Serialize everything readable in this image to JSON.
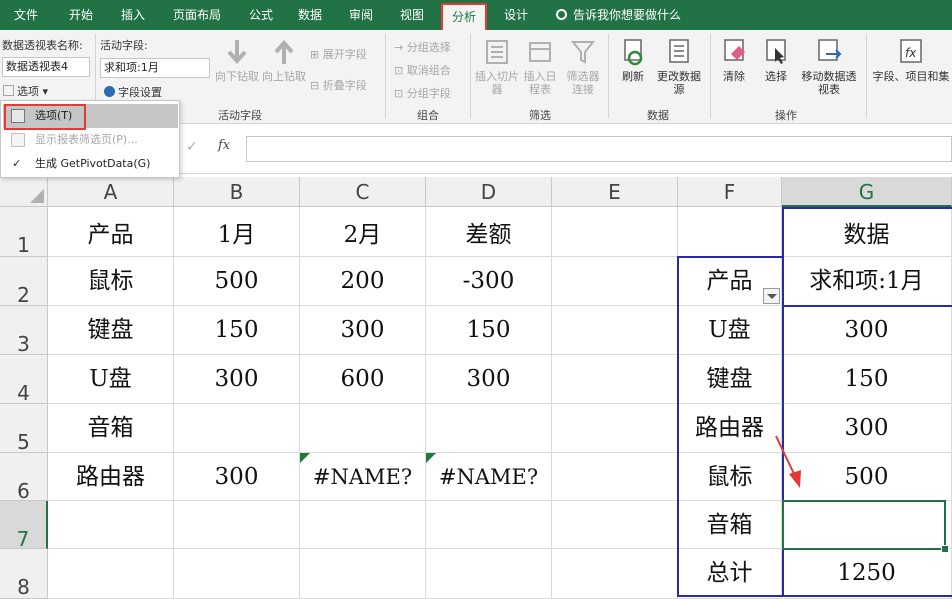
{
  "ribbon_tabs": [
    "文件",
    "开始",
    "插入",
    "页面布局",
    "公式",
    "数据",
    "审阅",
    "视图",
    "分析",
    "设计"
  ],
  "active_tab": "分析",
  "tell_me": "告诉我你想要做什么",
  "pivot_table": {
    "name_label": "数据透视表名称:",
    "name_value": "数据透视表4",
    "options_button": "选项"
  },
  "active_field": {
    "label": "活动字段:",
    "value": "求和项:1月",
    "field_settings": "字段设置",
    "drill_down": "向下钻取",
    "drill_up": "向上钻取",
    "expand": "展开字段",
    "collapse": "折叠字段",
    "group_name": "活动字段"
  },
  "group": {
    "group_selection": "分组选择",
    "ungroup": "取消组合",
    "group_field": "分组字段",
    "group_name": "组合"
  },
  "filter": {
    "slicer": "插入切片器",
    "timeline": "插入日程表",
    "connections": "筛选器连接",
    "group_name": "筛选"
  },
  "data_group": {
    "refresh": "刷新",
    "change_source": "更改数据源",
    "group_name": "数据"
  },
  "actions": {
    "clear": "清除",
    "select": "选择",
    "move": "移动数据透视表",
    "group_name": "操作"
  },
  "show": {
    "fields_items": "字段、项目和集"
  },
  "options_menu": [
    {
      "label": "选项(T)",
      "state": "highlighted"
    },
    {
      "label": "显示报表筛选页(P)...",
      "state": "disabled"
    },
    {
      "label": "生成 GetPivotData(G)",
      "state": "checked"
    }
  ],
  "formula_bar": {
    "fx": "fx",
    "value": ""
  },
  "columns": [
    "A",
    "B",
    "C",
    "D",
    "E",
    "F",
    "G"
  ],
  "rows": [
    "1",
    "2",
    "3",
    "4",
    "5",
    "6",
    "7",
    "8"
  ],
  "cells": {
    "A1": "产品",
    "B1": "1月",
    "C1": "2月",
    "D1": "差额",
    "A2": "鼠标",
    "B2": "500",
    "C2": "200",
    "D2": "-300",
    "A3": "键盘",
    "B3": "150",
    "C3": "300",
    "D3": "150",
    "A4": "U盘",
    "B4": "300",
    "C4": "600",
    "D4": "300",
    "A5": "音箱",
    "A6": "路由器",
    "B6": "300",
    "C6": "#NAME?",
    "D6": "#NAME?",
    "G1": "数据",
    "F2": "产品",
    "G2": "求和项:1月",
    "F3": "U盘",
    "G3": "300",
    "F4": "键盘",
    "G4": "150",
    "F5": "路由器",
    "G5": "300",
    "F6": "鼠标",
    "G6": "500",
    "F7": "音箱",
    "G7": "",
    "F8": "总计",
    "G8": "1250"
  },
  "colors": {
    "ribbon_green": "#217346",
    "highlight_red": "#e53935",
    "pivot_border": "#2a2aa8",
    "error_triangle": "#1e7a34"
  }
}
